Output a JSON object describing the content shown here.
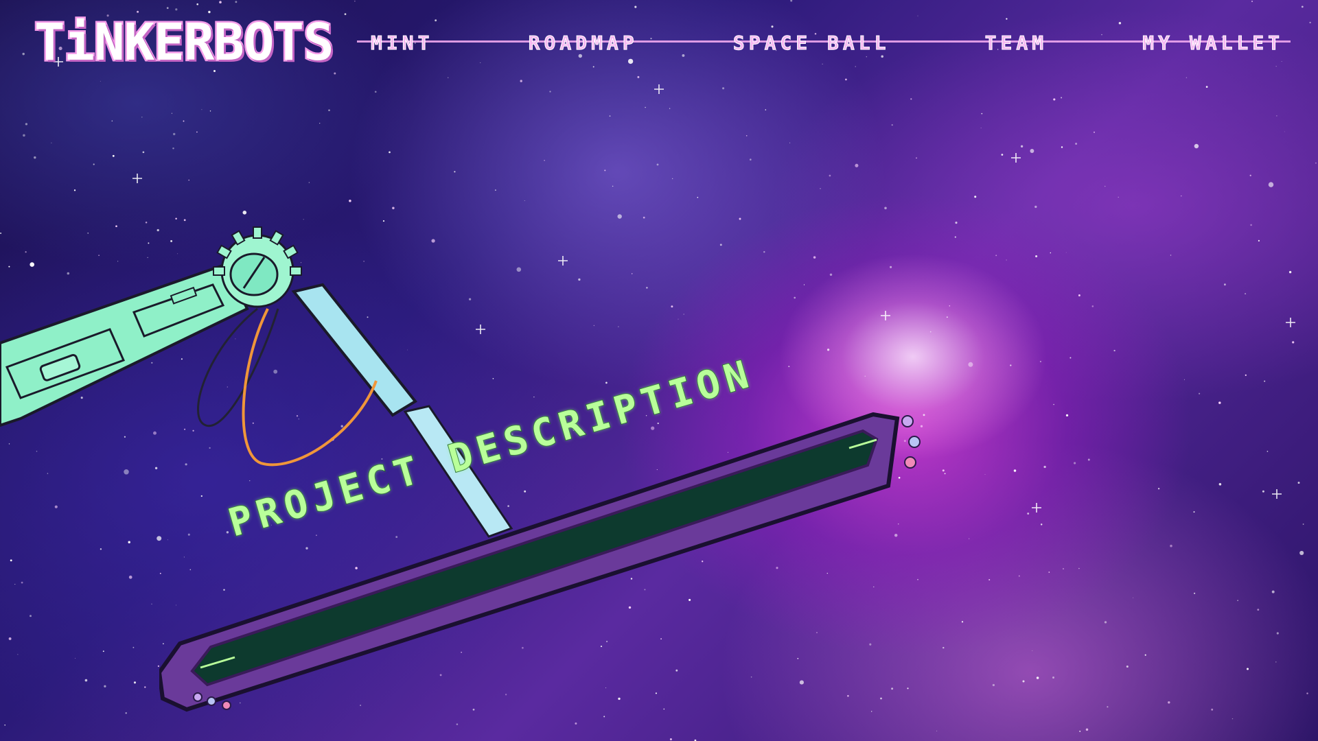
{
  "brand": {
    "name": "TiNKERBOTS"
  },
  "nav": {
    "items": [
      {
        "label": "MINT"
      },
      {
        "label": "ROADMAP"
      },
      {
        "label": "SPACE BALL"
      },
      {
        "label": "TEAM"
      },
      {
        "label": "MY WALLET"
      }
    ]
  },
  "hero": {
    "sign_title": "PROJECT DESCRIPTION"
  },
  "colors": {
    "nav_text": "#f6b8f2",
    "brand_outline": "#f49be8",
    "sign_frame": "#6a3a9a",
    "sign_screen": "#0d3a2e",
    "sign_text": "#b9ff9a",
    "arm_body": "#8ff0c8",
    "arm_forearm": "#a8e8f0"
  },
  "icons": {
    "arm": "robot-arm-icon",
    "lights": "indicator-lights-icon"
  }
}
